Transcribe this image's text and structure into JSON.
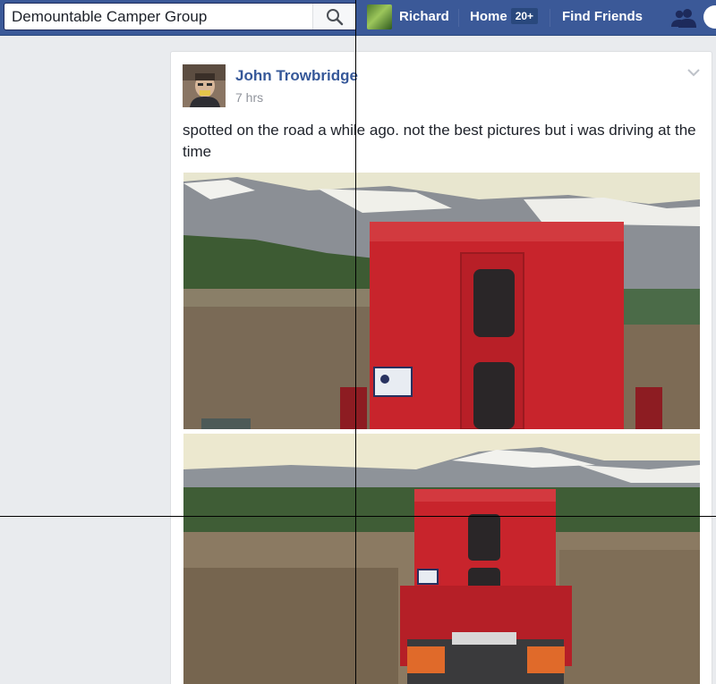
{
  "search": {
    "value": "Demountable Camper Group",
    "placeholder": ""
  },
  "nav": {
    "profile_name": "Richard",
    "home_label": "Home",
    "home_badge": "20+",
    "find_friends_label": "Find Friends"
  },
  "post": {
    "author": "John Trowbridge",
    "time": "7 hrs",
    "text": "spotted on the road a while ago. not the best pictures but i was driving at the time"
  },
  "colors": {
    "topbar": "#3b5998",
    "author_link": "#365899",
    "truck_red": "#c8242c"
  },
  "icons": [
    "search-icon",
    "friends-icon",
    "chevron-down-icon"
  ]
}
